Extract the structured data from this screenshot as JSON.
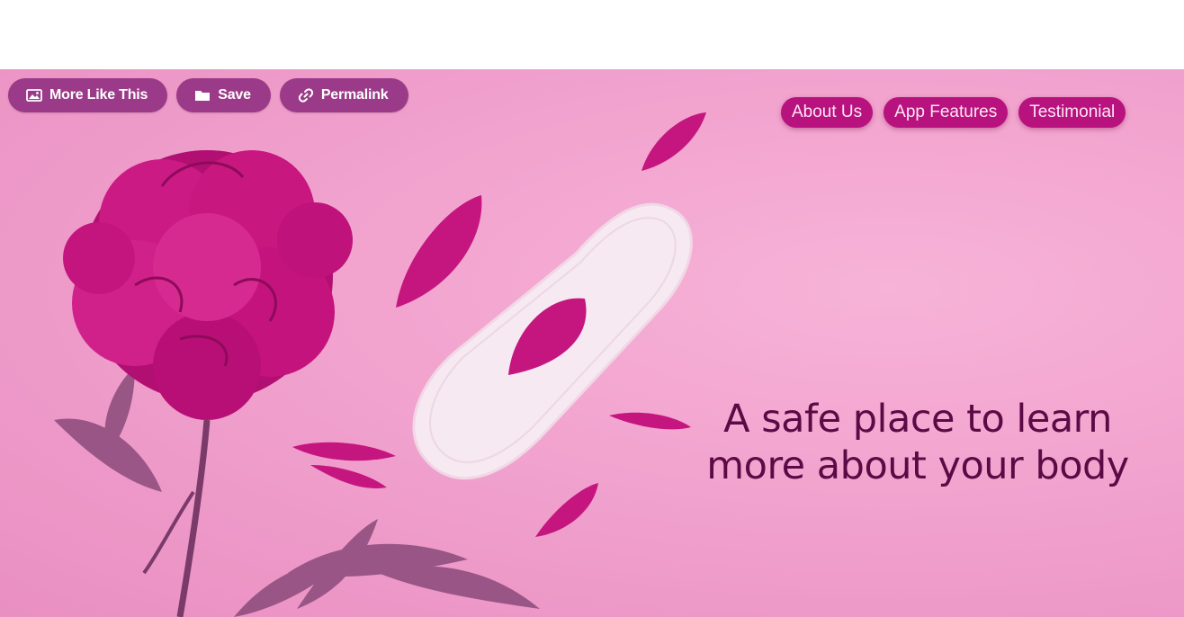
{
  "action_bar": {
    "more_like_this": {
      "label": "More Like This",
      "icon": "image-icon"
    },
    "save": {
      "label": "Save",
      "icon": "folder-icon"
    },
    "permalink": {
      "label": "Permalink",
      "icon": "link-icon"
    }
  },
  "nav": {
    "items": [
      {
        "label": "About Us"
      },
      {
        "label": "App Features"
      },
      {
        "label": "Testimonial"
      }
    ]
  },
  "hero": {
    "tagline_line1": "A safe place to learn",
    "tagline_line2": "more about your body"
  },
  "colors": {
    "hero_background": "#f2a4cf",
    "action_button": "#9b3a88",
    "nav_pill": "#b8127e",
    "tagline": "#5c0a45",
    "flower": "#c0127c"
  }
}
